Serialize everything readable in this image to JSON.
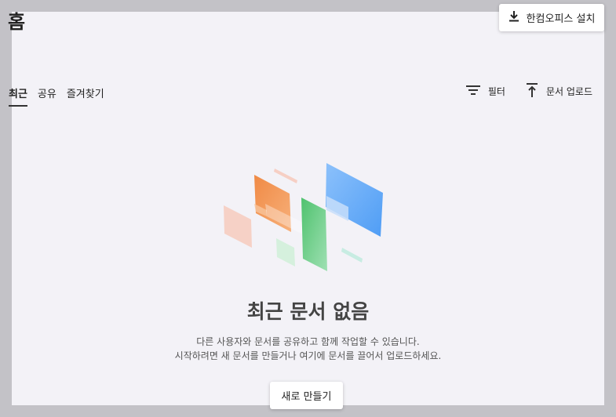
{
  "page": {
    "title": "홈"
  },
  "header": {
    "install_label": "한컴오피스 설치",
    "install_icon": "download-icon"
  },
  "tabs": [
    {
      "label": "최근",
      "active": true
    },
    {
      "label": "공유",
      "active": false
    },
    {
      "label": "즐겨찾기",
      "active": false
    }
  ],
  "toolbar": {
    "filter_label": "필터",
    "filter_icon": "filter-icon",
    "upload_label": "문서 업로드",
    "upload_icon": "upload-icon"
  },
  "empty_state": {
    "title": "최근 문서 없음",
    "line1": "다른 사용자와 문서를 공유하고 함께 작업할 수 있습니다.",
    "line2": "시작하려면 새 문서를 만들거나 여기에 문서를 끌어서 업로드하세요.",
    "button_label": "새로 만들기"
  },
  "colors": {
    "orange": "#f28a45",
    "green": "#5ecb7a",
    "blue": "#5aa5f7",
    "salmon": "#f5c9bc",
    "mint": "#c4ecd6"
  }
}
